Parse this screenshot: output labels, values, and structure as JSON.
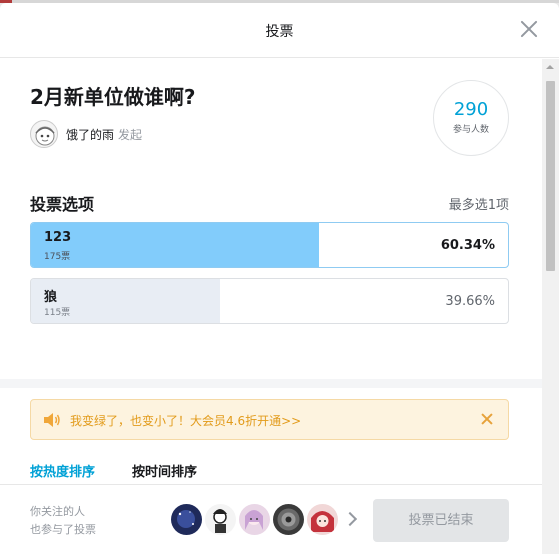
{
  "header": {
    "title": "投票"
  },
  "poll": {
    "question": "2月新单位做谁啊?",
    "author": "饿了的雨",
    "author_suffix": "发起",
    "participants": "290",
    "participants_label": "参与人数"
  },
  "options_section": {
    "title": "投票选项",
    "limit": "最多选1项"
  },
  "options": [
    {
      "label": "123",
      "votes": "175票",
      "percent_text": "60.34%",
      "percent": 60.34,
      "selected": true
    },
    {
      "label": "狼",
      "votes": "115票",
      "percent_text": "39.66%",
      "percent": 39.66,
      "selected": false
    }
  ],
  "promo": {
    "text": "我变绿了，也变小了！大会员4.6折开通>>"
  },
  "sort": {
    "hot": "按热度排序",
    "time": "按时间排序"
  },
  "footer": {
    "line1": "你关注的人",
    "line2": "也参与了投票",
    "vote_ended": "投票已结束"
  },
  "colors": {
    "accent": "#00a1d6",
    "selected_fill": "#82ccfb",
    "promo_text": "#e29b1b"
  }
}
